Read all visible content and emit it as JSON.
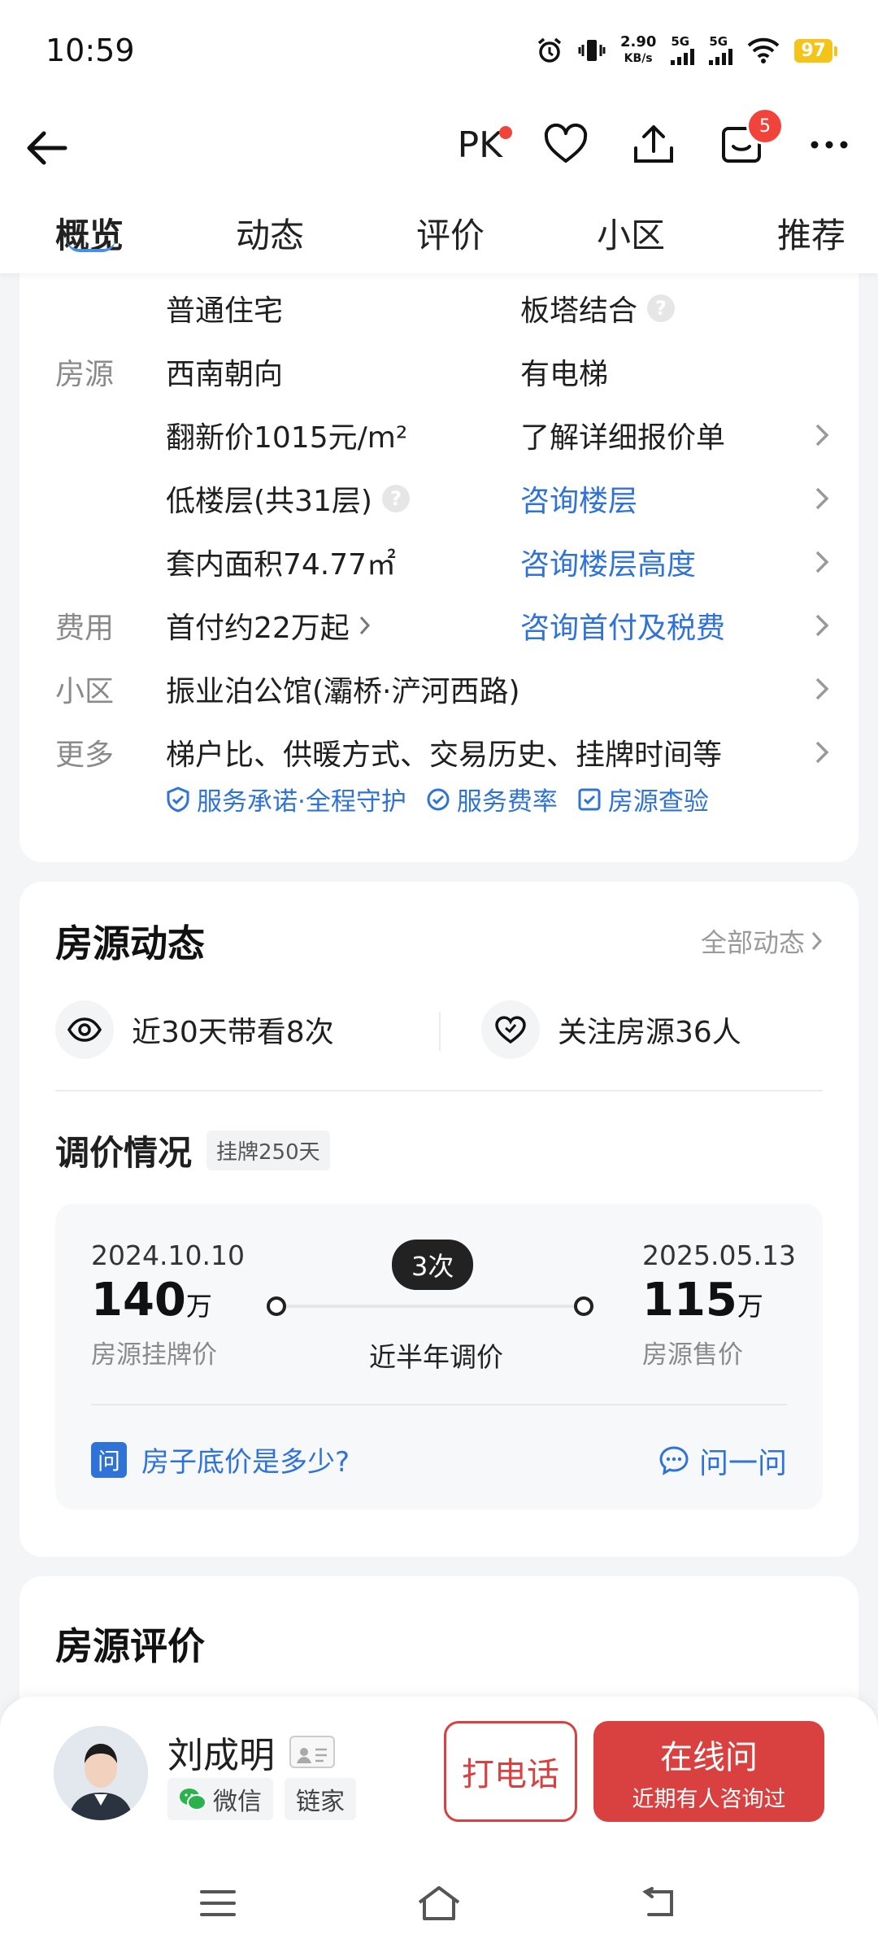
{
  "status_bar": {
    "time": "10:59",
    "net_speed_value": "2.90",
    "net_speed_unit": "KB/s",
    "sim1": "5G",
    "sim2": "5G",
    "battery": "97"
  },
  "header": {
    "pk_label": "PK",
    "message_badge": "5"
  },
  "tabs": [
    {
      "label": "概览",
      "active": true
    },
    {
      "label": "动态",
      "active": false
    },
    {
      "label": "评价",
      "active": false
    },
    {
      "label": "小区",
      "active": false
    },
    {
      "label": "推荐",
      "active": false
    }
  ],
  "details": {
    "row0": {
      "value": "普通住宅",
      "value2": "板塔结合"
    },
    "row1": {
      "label": "房源",
      "value": "西南朝向",
      "value2": "有电梯"
    },
    "row2": {
      "value": "翻新价1015元/m²",
      "value2": "了解详细报价单"
    },
    "row3": {
      "value": "低楼层(共31层)",
      "value2": "咨询楼层"
    },
    "row4": {
      "value": "套内面积74.77㎡",
      "value2": "咨询楼层高度"
    },
    "row5": {
      "label": "费用",
      "value": "首付约22万起",
      "value2": "咨询首付及税费"
    },
    "row6": {
      "label": "小区",
      "value": "振业泊公馆(灞桥·浐河西路)"
    },
    "row7": {
      "label": "更多",
      "value": "梯户比、供暖方式、交易历史、挂牌时间等"
    },
    "services": [
      "服务承诺·全程守护",
      "服务费率",
      "房源查验"
    ]
  },
  "dynamics": {
    "title": "房源动态",
    "all_link": "全部动态",
    "views": "近30天带看8次",
    "follows": "关注房源36人",
    "price_title": "调价情况",
    "listing_days": "挂牌250天",
    "start_date": "2024.10.10",
    "start_price": "140",
    "start_unit": "万",
    "start_label": "房源挂牌价",
    "adjust_count": "3次",
    "adjust_label": "近半年调价",
    "end_date": "2025.05.13",
    "end_price": "115",
    "end_unit": "万",
    "end_label": "房源售价",
    "ask_icon": "问",
    "ask_question": "房子底价是多少?",
    "ask_button": "问一问"
  },
  "review": {
    "title": "房源评价"
  },
  "agent": {
    "name": "刘成明",
    "tag_wechat": "微信",
    "tag_company": "链家",
    "call_label": "打电话",
    "online_label": "在线问",
    "online_sub": "近期有人咨询过"
  },
  "colors": {
    "accent_blue": "#2f72d8",
    "accent_red": "#d94040",
    "badge_red": "#f0443a"
  }
}
